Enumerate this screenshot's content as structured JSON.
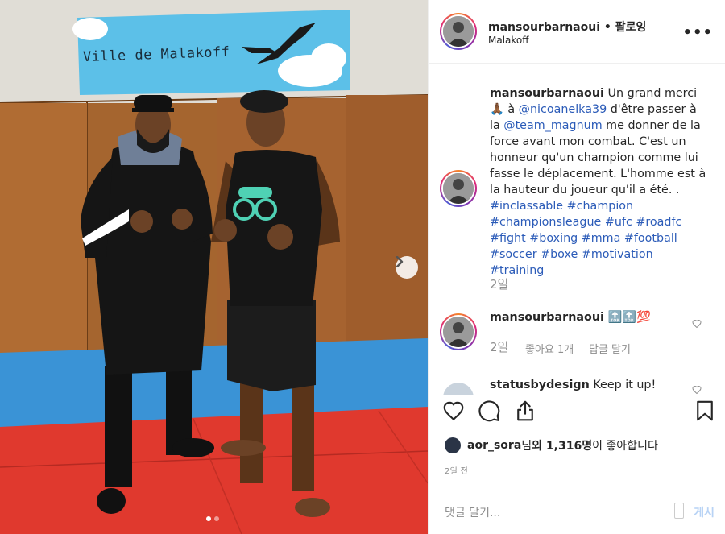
{
  "header": {
    "username": "mansourbarnaoui",
    "separator": "•",
    "follow_status": "팔로잉",
    "location": "Malakoff",
    "more": "•••"
  },
  "photo": {
    "sign_text": "Ville de Malakoff",
    "carousel_position": 1,
    "carousel_total": 2
  },
  "caption": {
    "username": "mansourbarnaoui",
    "text_a": " Un grand merci 🙏🏾 à ",
    "mention_1": "@nicoanelka39",
    "text_b": " d'être passer à la ",
    "mention_2": "@team_magnum",
    "text_c": " me donner de la force avant mon combat. C'est un honneur qu'un champion comme lui fasse le déplacement. L'homme est à la hauteur du joueur qu'il a été. . ",
    "hashtags": "#inclassable #champion #championsleague #ufc #roadfc #fight #boxing #mma #football #soccer #boxe #motivation #training",
    "time": "2일"
  },
  "comments": [
    {
      "username": "mansourbarnaoui",
      "text": " 🔝🔝💯",
      "time": "2일",
      "likes": "좋아요 1개",
      "reply": "답글 달기"
    },
    {
      "username": "statusbydesign",
      "text": " Keep it up!"
    }
  ],
  "likes": {
    "user": "aor_sora",
    "suffix_a": "님 ",
    "others": "외 1,316명",
    "suffix_b": "이 좋아합니다"
  },
  "date": "2일 전",
  "compose": {
    "placeholder": "댓글 달기...",
    "post": "게시"
  }
}
